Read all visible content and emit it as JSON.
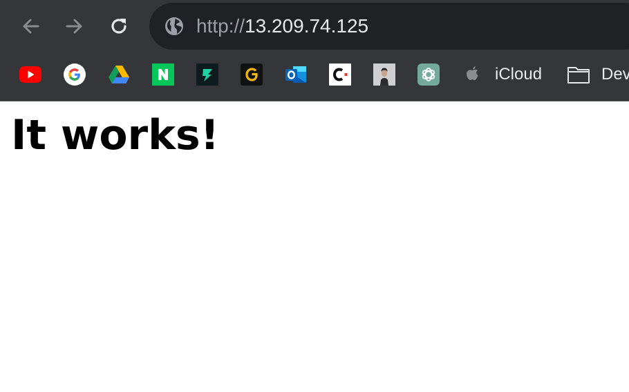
{
  "browser": {
    "address_bar": {
      "scheme": "http://",
      "host": "13.209.74.125"
    },
    "nav_icons": [
      "back-arrow-icon",
      "forward-arrow-icon",
      "reload-icon",
      "globe-icon"
    ],
    "bookmarks": [
      {
        "icon": "youtube-icon",
        "color": "#ff0000"
      },
      {
        "icon": "google-icon",
        "color": "#4285f4"
      },
      {
        "icon": "google-drive-icon",
        "color": "#0f9d58"
      },
      {
        "icon": "naver-icon",
        "color": "#03c75a",
        "glyph": "N"
      },
      {
        "icon": "green-z-icon",
        "color": "#1dd1a1"
      },
      {
        "icon": "g-gold-icon",
        "color": "#f5b800",
        "glyph": "G"
      },
      {
        "icon": "outlook-icon",
        "color": "#0078d4",
        "glyph": "O"
      },
      {
        "icon": "c-logo-icon",
        "color": "#e53935"
      },
      {
        "icon": "person-photo-icon",
        "color": "#444444"
      },
      {
        "icon": "chatgpt-icon",
        "color": "#74aa9c"
      },
      {
        "icon": "apple-icon",
        "label": "iCloud"
      },
      {
        "icon": "folder-icon",
        "label": "Dev"
      }
    ]
  },
  "page": {
    "heading": "It works!"
  },
  "colors": {
    "chrome_bg": "#35363a",
    "omnibox_bg": "#202124",
    "url_dim": "#9aa0a6",
    "url_bright": "#e8eaed",
    "page_bg": "#ffffff"
  }
}
